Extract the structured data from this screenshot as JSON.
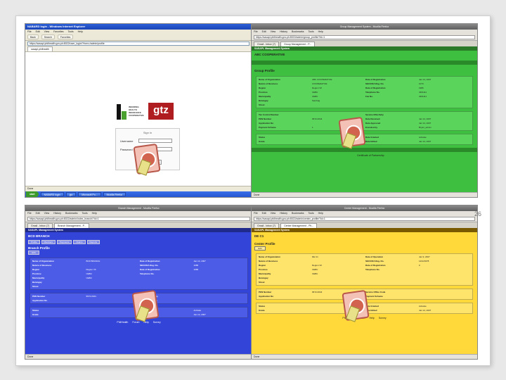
{
  "slide": {
    "number": "26"
  },
  "ie_window": {
    "title": "NABARD login - Windows Internet Explorer",
    "menu": [
      "File",
      "Edit",
      "View",
      "Favorites",
      "Tools",
      "Help"
    ],
    "toolbar": [
      "Back",
      "Search",
      "Favorites"
    ],
    "address": "https://sasapl.philhealth.gov.ph:8022/user_login/?from=/admin/profile",
    "tab": "sasapl.philhealth",
    "logo_text": [
      "INSURING",
      "HEALTH",
      "INSURANCE",
      "COOPERATIVE"
    ],
    "gtz": "gtz",
    "login": {
      "heading": "Sign in",
      "username_label": "Username",
      "password_label": "Password",
      "submit": "Submit"
    },
    "footer_links": [
      "PhilHealth",
      "Forum",
      "Help",
      "Survey"
    ],
    "status": "Done",
    "taskbar": {
      "start": "start",
      "items": [
        "NABARD login",
        "gtz",
        "Microsoft Po...",
        "Mozilla Firefox"
      ]
    }
  },
  "ff_green": {
    "title": "Group Management System - Mozilla Firefox",
    "menu": [
      "File",
      "Edit",
      "View",
      "History",
      "Bookmarks",
      "Tools",
      "Help"
    ],
    "url": "https://sasapl.philhealth.gov.ph:8022/admin/group_profile/?id=1",
    "tabs": [
      "Gmail - Inbox (7)",
      "Group Management - P..."
    ],
    "system": "SASAPL Management System",
    "org": "ABC COOPERATIVE",
    "profile_title": "Group Profile",
    "section1": [
      [
        "Name of Organization",
        "ABC COOPERATIVE",
        "Date of Registration",
        "Jan 14, 2007"
      ],
      [
        "Nature of Business",
        "COOPERATIVE",
        "SEC/CDA Reg. No.",
        "1073"
      ],
      [
        "Region",
        "Region VII",
        "Date of Registration",
        "1986"
      ],
      [
        "Province",
        "CEBU",
        "Telephone No.",
        "3461111"
      ],
      [
        "Municipality",
        "CEBU",
        "Fax No.",
        "3461111"
      ],
      [
        "Barangay",
        "Sambag",
        "",
        ""
      ],
      [
        "Street",
        "",
        "",
        ""
      ]
    ],
    "section2": [
      [
        "Tax Control Number",
        "",
        "Service Effectivity",
        ""
      ],
      [
        "PEN Number",
        "9672-0044",
        "Date Received",
        "Jan 14, 2007"
      ],
      [
        "Application No",
        "",
        "Date Approved",
        "Jan 14, 2007"
      ],
      [
        "Payment Scheme",
        "1",
        "Encoded by",
        "Bryan_admin"
      ]
    ],
    "section3": [
      [
        "Status",
        "",
        "Date Granted",
        "Activate"
      ],
      [
        "Grade",
        "",
        "Date Edited",
        "Jan 14, 2007"
      ]
    ],
    "bottom": "Certificate of Partnership",
    "status": "Done"
  },
  "ff_blue": {
    "title": "Branch Management - Mozilla Firefox",
    "menu": [
      "File",
      "Edit",
      "View",
      "History",
      "Bookmarks",
      "Tools",
      "Help"
    ],
    "url": "https://sasapl.philhealth.gov.ph:8022/admin/index_branch/?id=1",
    "tabs": [
      "Gmail - Inbox (7)",
      "Branch Management - P..."
    ],
    "system": "SASAPL Management System",
    "branch": "BCD BRANCH",
    "nav": [
      "Profile",
      "Members",
      "Payments",
      "Claims",
      "Reports"
    ],
    "profile_title": "Branch Profile",
    "edit": "Edit",
    "section1": [
      [
        "Name of Organization",
        "BCD BRANCH",
        "Date of Registration",
        "Jan 14, 2007"
      ],
      [
        "Nature of Business",
        "",
        "SEC/CDA Reg. No.",
        "1086"
      ],
      [
        "Region",
        "Region VII",
        "Date of Registration",
        "1986"
      ],
      [
        "Province",
        "CEBU",
        "Telephone No.",
        ""
      ],
      [
        "Municipality",
        "CEBU",
        "",
        ""
      ],
      [
        "Barangay",
        "",
        "",
        ""
      ],
      [
        "Street",
        "",
        "",
        ""
      ]
    ],
    "section2": [
      [
        "PEN Number",
        "9672-0044",
        "Service Effectivity",
        ""
      ],
      [
        "Application No",
        "",
        "Payment Scheme",
        ""
      ]
    ],
    "section3": [
      [
        "Status",
        "",
        "Date Granted",
        "Activate"
      ],
      [
        "Grade",
        "",
        "Date Edited",
        "Jan 14, 2007"
      ]
    ],
    "footer_links": [
      "PhilHealth",
      "Forum",
      "Help",
      "Survey"
    ],
    "status": "Done"
  },
  "ff_yellow": {
    "title": "Center Management - Mozilla Firefox",
    "menu": [
      "File",
      "Edit",
      "View",
      "History",
      "Bookmarks",
      "Tools",
      "Help"
    ],
    "url": "https://sasapl.philhealth.gov.ph:8022/admin/center_profile/?id=1",
    "tabs": [
      "Gmail - Inbox (7)",
      "Center Management - Ph..."
    ],
    "system": "SASAPL Management System",
    "center": "DE C1",
    "profile_title": "Center Profile",
    "edit": "Edit",
    "section1": [
      [
        "Name of Organization",
        "DE C1",
        "Date of Operation",
        "Jan 9, 2007"
      ],
      [
        "Nature of Business",
        "",
        "SEC/CDA Reg. No.",
        "1234-5678"
      ],
      [
        "Region",
        "Region VII",
        "Date of Registration",
        "0"
      ],
      [
        "Province",
        "CEBU",
        "Telephone No.",
        ""
      ],
      [
        "Municipality",
        "CEBU",
        "",
        ""
      ],
      [
        "Barangay",
        "",
        "",
        ""
      ],
      [
        "Street",
        "",
        "",
        ""
      ]
    ],
    "section2": [
      [
        "PEN Number",
        "9672-0044",
        "Service Office Code",
        ""
      ],
      [
        "Application No",
        "",
        "Payment Scheme",
        ""
      ]
    ],
    "section3": [
      [
        "Status",
        "",
        "Date Granted",
        "Activate"
      ],
      [
        "Grade",
        "",
        "Date Edited",
        "Jan 14, 2007"
      ]
    ],
    "footer_links": [
      "PhilHealth",
      "Forum",
      "Help",
      "Survey"
    ],
    "status": "Done"
  }
}
